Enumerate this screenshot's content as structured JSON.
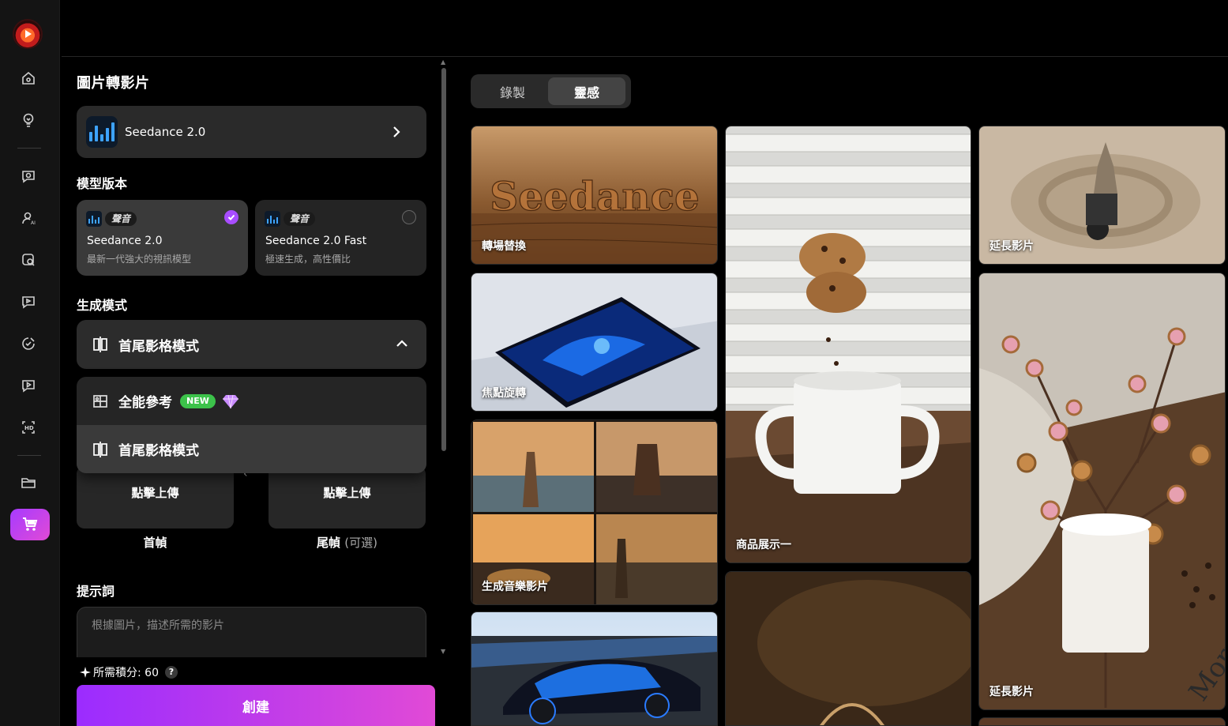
{
  "sidebar": {
    "items": [
      "home-icon",
      "bulb-icon",
      "chat-search-icon",
      "ai-avatar-icon",
      "image-search-icon",
      "video-chat-icon",
      "sticker-icon",
      "video-play-icon",
      "hd-icon",
      "folder-icon",
      "cart-icon"
    ]
  },
  "panel": {
    "title": "圖片轉影片",
    "model": {
      "name": "Seedance 2.0"
    },
    "version_label": "模型版本",
    "versions": [
      {
        "tag": "聲音",
        "name": "Seedance 2.0",
        "desc": "最新一代強大的視訊模型",
        "selected": true
      },
      {
        "tag": "聲音",
        "name": "Seedance 2.0 Fast",
        "desc": "極速生成，高性價比",
        "selected": false
      }
    ],
    "mode_label": "生成模式",
    "mode_selected": "首尾影格模式",
    "mode_options": [
      {
        "label": "全能參考",
        "badge": "NEW"
      },
      {
        "label": "首尾影格模式"
      }
    ],
    "upload": {
      "first_button": "點擊上傳",
      "last_button": "點擊上傳",
      "first_caption": "首幀",
      "last_caption": "尾幀",
      "last_optional": "(可選)"
    },
    "prompt_label": "提示詞",
    "prompt_placeholder": "根據圖片，描述所需的影片",
    "credits_text": "所需積分: 60",
    "help": "?",
    "create": "創建"
  },
  "gallery": {
    "tabs": [
      "錄製",
      "靈感"
    ],
    "active_tab": "靈感",
    "cards": [
      {
        "caption": "轉場替換",
        "art_text": "Seedance"
      },
      {
        "caption": "焦點旋轉"
      },
      {
        "caption": "生成音樂影片"
      },
      {
        "caption": ""
      },
      {
        "caption": "商品展示一"
      },
      {
        "caption": ""
      },
      {
        "caption": "延長影片"
      },
      {
        "caption": "延長影片",
        "art_text": "Mornin"
      }
    ]
  },
  "colors": {
    "accent": "#a84dff",
    "create_gradient_start": "#9b2cff",
    "create_gradient_end": "#e14ad6",
    "new_badge": "#3cc24a"
  }
}
